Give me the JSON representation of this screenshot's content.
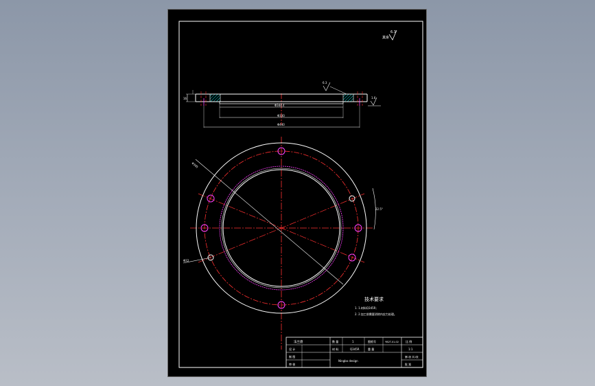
{
  "drawing": {
    "roughness_note": {
      "prefix": "其余",
      "value": "6.3"
    },
    "section_view": {
      "roughness_value": "6.3",
      "height_dim": "16",
      "chamfer_dim": "1.6",
      "inner_diameter": "Φ344.4",
      "middle_diameter": "Φ330",
      "outer_diameter": "Φ440"
    },
    "plan_view": {
      "bolt_circle_dim": "Φ395",
      "hole_dim": "Φ22",
      "angle_dim": "22.5°"
    },
    "technical_requirements": {
      "title": "技术要求",
      "items": [
        "1. 1.材料Q345R;",
        "2. 2.加工前需要消除内应力处理。"
      ]
    },
    "title_block": {
      "part_name": "法兰盘",
      "label_qty": "数 量",
      "qty": "1",
      "label_mat": "材 料",
      "mat": "Q345R",
      "label_draw_no": "图纸号",
      "draw_no": "YB2T-01-02",
      "label_ratio": "比 例",
      "ratio": "1:1",
      "label_designer": "设 计",
      "label_drawn": "制 图",
      "label_checked": "审 核",
      "label_sheet": "第1张 共1张",
      "school": "",
      "label_approved": "批 准",
      "label_weight": "重 量",
      "company": "Ningbo design"
    }
  }
}
